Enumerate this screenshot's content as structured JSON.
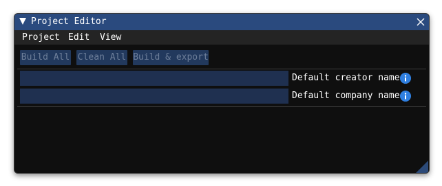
{
  "window": {
    "title": "Project Editor"
  },
  "menu": {
    "items": [
      {
        "label": "Project"
      },
      {
        "label": "Edit"
      },
      {
        "label": "View"
      }
    ]
  },
  "toolbar": {
    "buttons": [
      {
        "label": "Build All"
      },
      {
        "label": "Clean All"
      },
      {
        "label": "Build & export"
      }
    ]
  },
  "fields": [
    {
      "label": "Default creator name",
      "value": ""
    },
    {
      "label": "Default company name",
      "value": ""
    }
  ],
  "icons": {
    "collapse": "collapse-triangle-icon",
    "close": "close-icon",
    "info": "info-icon",
    "resize": "resize-grip-icon"
  },
  "colors": {
    "titlebar": "#2a4a7e",
    "window_bg": "#0f0f0f",
    "menubar_bg": "#242424",
    "button_bg": "#22395d",
    "button_text": "#6e7f9a",
    "input_bg": "#1f3050",
    "info_blue": "#2f7fe0"
  }
}
